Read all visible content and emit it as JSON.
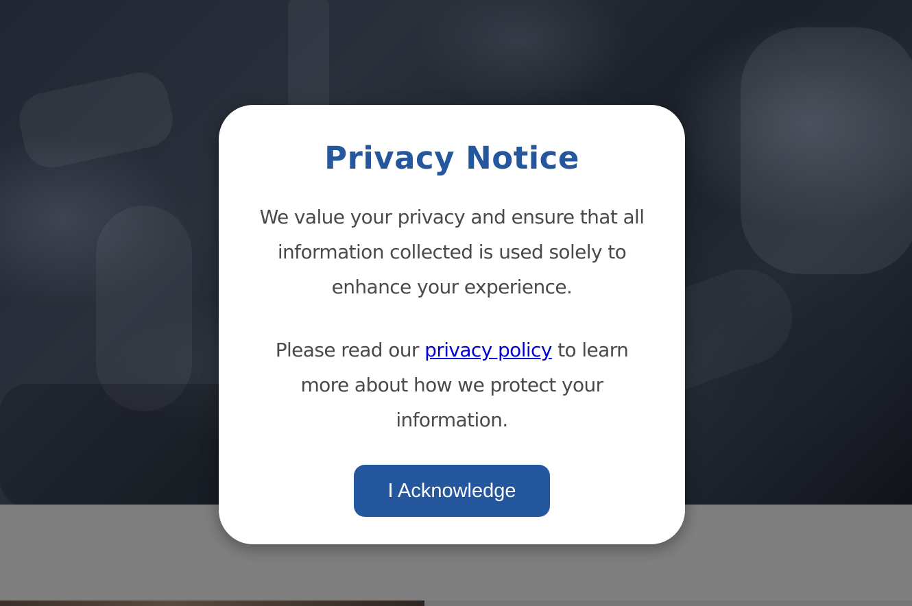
{
  "modal": {
    "title": "Privacy Notice",
    "paragraph1": "We value your privacy and ensure that all information collected is used solely to enhance your experience.",
    "paragraph2_before": "Please read our ",
    "paragraph2_link": "privacy policy",
    "paragraph2_after": " to learn more about how we protect your information.",
    "button_label": "I Acknowledge"
  },
  "colors": {
    "accent": "#24579d",
    "link": "#0000d6",
    "text": "#4a4a4a",
    "overlay_band": "#7f7f7f"
  }
}
